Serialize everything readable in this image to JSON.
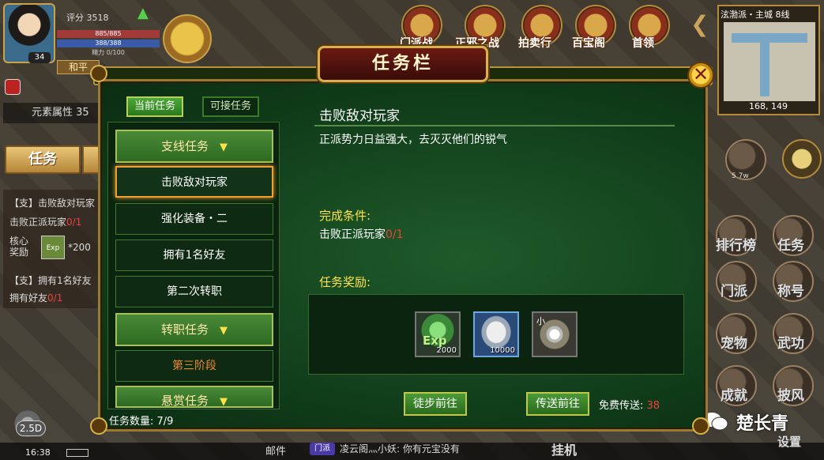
{
  "hud": {
    "avatar_level": "34",
    "score": "评分 3518",
    "hp": "885/885",
    "mp": "388/388",
    "stamina": "精力 0/100",
    "peace_badge": "和平",
    "element_attr": "元素属性",
    "element_value": "35",
    "task_tab": "任务",
    "side_tasks": [
      {
        "tag": "【支】",
        "name": "击败敌对玩家",
        "sub": "击败正派玩家",
        "progress": "0/1"
      },
      {
        "tag": "【支】",
        "name": "拥有1名好友",
        "sub": "拥有好友",
        "progress": "0/1"
      }
    ],
    "core_reward_label": "核心\n奖励",
    "core_reward_value": "*200",
    "zoom": "2.5D",
    "clock": "16:38",
    "mail": "邮件",
    "chat_channel": "门派",
    "chat_message": "凌云阁灬小妖: 你有元宝没有",
    "hangup": "挂机",
    "top_menu": [
      "门派战",
      "正邪之战",
      "拍卖行",
      "百宝阁",
      "首领"
    ],
    "minimap_title": "泫渤派・主城 8线",
    "minimap_coords": "168, 149",
    "right_buttons": [
      "排行榜",
      "任务",
      "门派",
      "称号",
      "宠物",
      "武功",
      "成就",
      "披风",
      "设置"
    ],
    "small_counter": "5 7w",
    "watermark": "楚长青"
  },
  "dialog": {
    "title": "任务栏",
    "close_symbol": "✕",
    "tabs": {
      "current": "当前任务",
      "available": "可接任务"
    },
    "groups": [
      {
        "label": "支线任务",
        "items": [
          "击败敌对玩家",
          "强化装备・二",
          "拥有1名好友",
          "第二次转职"
        ]
      },
      {
        "label": "转职任务",
        "items": [
          "第三阶段"
        ]
      },
      {
        "label": "悬赏任务",
        "items": []
      }
    ],
    "selected_item": "击败敌对玩家",
    "task_count": "任务数量: 7/9",
    "detail": {
      "title": "击败敌对玩家",
      "description": "正派势力日益强大，去灭灭他们的锐气",
      "condition_label": "完成条件:",
      "condition_text": "击败正派玩家",
      "condition_progress": "0/1",
      "reward_label": "任务奖励:",
      "rewards": [
        {
          "icon": "exp-icon",
          "tag": "Exp",
          "count": "2000"
        },
        {
          "icon": "silver-ingot-icon",
          "count": "10000"
        },
        {
          "icon": "pearl-stone-icon",
          "small_label": "小",
          "count": ""
        }
      ]
    },
    "buttons": {
      "walk": "徒步前往",
      "teleport": "传送前往"
    },
    "free_teleport_label": "免费传送:",
    "free_teleport_count": "38"
  },
  "colors": {
    "dialog_bg": "#1f5a2a",
    "gold_border": "#d9b24a",
    "highlight_yellow": "#ffe24a",
    "alert_red": "#f04040",
    "stage_orange": "#f08a2a"
  }
}
